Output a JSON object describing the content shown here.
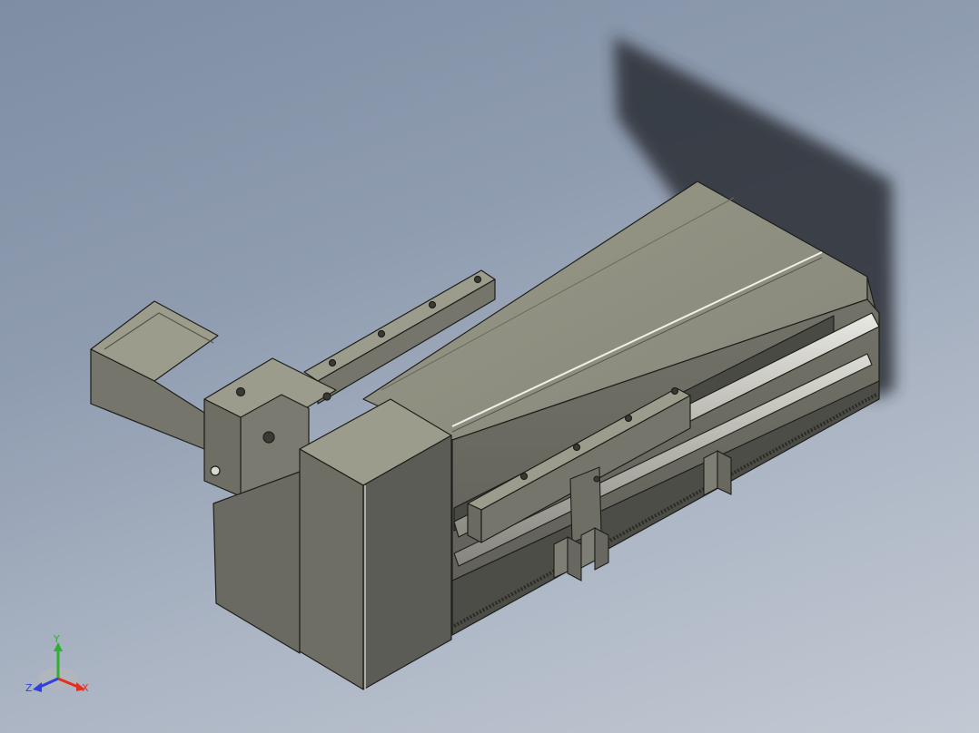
{
  "viewport": {
    "background_top": "#7e8da3",
    "background_bottom": "#c3c9d3",
    "model_color": "#8a8a78",
    "shadow_color": "#2a2e36"
  },
  "triad": {
    "x_label": "X",
    "y_label": "Y",
    "z_label": "Z",
    "x_color": "#e03020",
    "y_color": "#30b030",
    "z_color": "#3040e0"
  }
}
